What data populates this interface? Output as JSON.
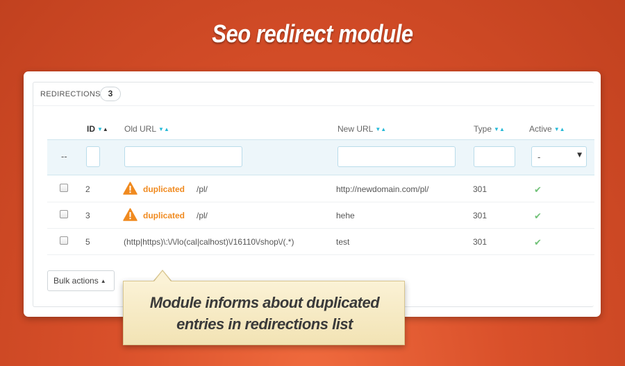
{
  "hero": {
    "title": "Seo redirect module"
  },
  "panel": {
    "title": "REDIRECTIONS",
    "count": "3"
  },
  "columns": {
    "id": "ID",
    "old_url": "Old URL",
    "new_url": "New URL",
    "type": "Type",
    "active": "Active"
  },
  "filters": {
    "placeholder_dash": "--",
    "active_value": "-"
  },
  "rows": [
    {
      "id": "2",
      "duplicated": "duplicated",
      "old_url": "/pl/",
      "new_url": "http://newdomain.com/pl/",
      "type": "301",
      "active": true
    },
    {
      "id": "3",
      "duplicated": "duplicated",
      "old_url": "/pl/",
      "new_url": "hehe",
      "type": "301",
      "active": true
    },
    {
      "id": "5",
      "duplicated": "",
      "old_url": "(http|https)\\:\\/\\/lo(cal|calhost)\\/16110\\/shop\\/(.*)",
      "new_url": "test",
      "type": "301",
      "active": true
    }
  ],
  "bulk_actions": {
    "label": "Bulk actions"
  },
  "tooltip": {
    "line1": "Module informs about duplicated",
    "line2": "entries in redirections list"
  },
  "colors": {
    "accent": "#25b9d7",
    "warning": "#f08a1f",
    "success": "#72c279",
    "background": "#d9502a"
  },
  "icons": {
    "warning": "warning-triangle-icon",
    "check": "check-icon",
    "sort": "sort-arrows-icon",
    "caret": "caret-down-icon"
  }
}
